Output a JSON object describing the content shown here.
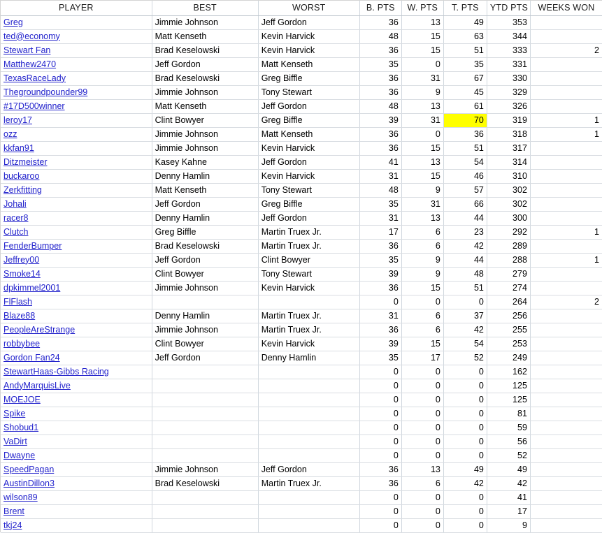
{
  "table": {
    "columns": [
      {
        "key": "player",
        "label": "PLAYER",
        "align": "left"
      },
      {
        "key": "best",
        "label": "BEST",
        "align": "left"
      },
      {
        "key": "worst",
        "label": "WORST",
        "align": "left"
      },
      {
        "key": "bpts",
        "label": "B. PTS",
        "align": "right"
      },
      {
        "key": "wpts",
        "label": "W. PTS",
        "align": "right"
      },
      {
        "key": "tpts",
        "label": "T. PTS",
        "align": "right"
      },
      {
        "key": "ytd",
        "label": "YTD PTS",
        "align": "right"
      },
      {
        "key": "weeks",
        "label": "WEEKS WON",
        "align": "right"
      }
    ],
    "highlight_color": "#ffff00",
    "link_color": "#2222cc",
    "rows": [
      {
        "player": "Greg",
        "best": "Jimmie Johnson",
        "worst": "Jeff Gordon",
        "bpts": "36",
        "wpts": "13",
        "tpts": "49",
        "ytd": "353",
        "weeks": ""
      },
      {
        "player": "ted@economy",
        "best": "Matt Kenseth",
        "worst": "Kevin Harvick",
        "bpts": "48",
        "wpts": "15",
        "tpts": "63",
        "ytd": "344",
        "weeks": ""
      },
      {
        "player": "Stewart Fan",
        "best": "Brad Keselowski",
        "worst": "Kevin Harvick",
        "bpts": "36",
        "wpts": "15",
        "tpts": "51",
        "ytd": "333",
        "weeks": "2"
      },
      {
        "player": "Matthew2470",
        "best": "Jeff Gordon",
        "worst": "Matt Kenseth",
        "bpts": "35",
        "wpts": "0",
        "tpts": "35",
        "ytd": "331",
        "weeks": ""
      },
      {
        "player": "TexasRaceLady",
        "best": "Brad Keselowski",
        "worst": "Greg Biffle",
        "bpts": "36",
        "wpts": "31",
        "tpts": "67",
        "ytd": "330",
        "weeks": ""
      },
      {
        "player": "Thegroundpounder99",
        "best": "Jimmie Johnson",
        "worst": "Tony Stewart",
        "bpts": "36",
        "wpts": "9",
        "tpts": "45",
        "ytd": "329",
        "weeks": ""
      },
      {
        "player": "#17D500winner",
        "best": "Matt Kenseth",
        "worst": "Jeff Gordon",
        "bpts": "48",
        "wpts": "13",
        "tpts": "61",
        "ytd": "326",
        "weeks": ""
      },
      {
        "player": "leroy17",
        "best": "Clint Bowyer",
        "worst": "Greg Biffle",
        "bpts": "39",
        "wpts": "31",
        "tpts": "70",
        "ytd": "319",
        "weeks": "1",
        "highlight": "tpts"
      },
      {
        "player": "ozz",
        "best": "Jimmie Johnson",
        "worst": "Matt Kenseth",
        "bpts": "36",
        "wpts": "0",
        "tpts": "36",
        "ytd": "318",
        "weeks": "1"
      },
      {
        "player": "kkfan91",
        "best": "Jimmie Johnson",
        "worst": "Kevin Harvick",
        "bpts": "36",
        "wpts": "15",
        "tpts": "51",
        "ytd": "317",
        "weeks": ""
      },
      {
        "player": "Ditzmeister",
        "best": "Kasey Kahne",
        "worst": "Jeff Gordon",
        "bpts": "41",
        "wpts": "13",
        "tpts": "54",
        "ytd": "314",
        "weeks": ""
      },
      {
        "player": "buckaroo",
        "best": "Denny Hamlin",
        "worst": "Kevin Harvick",
        "bpts": "31",
        "wpts": "15",
        "tpts": "46",
        "ytd": "310",
        "weeks": ""
      },
      {
        "player": "Zerkfitting",
        "best": "Matt Kenseth",
        "worst": "Tony Stewart",
        "bpts": "48",
        "wpts": "9",
        "tpts": "57",
        "ytd": "302",
        "weeks": ""
      },
      {
        "player": "Johali",
        "best": "Jeff Gordon",
        "worst": "Greg Biffle",
        "bpts": "35",
        "wpts": "31",
        "tpts": "66",
        "ytd": "302",
        "weeks": ""
      },
      {
        "player": "racer8",
        "best": "Denny Hamlin",
        "worst": "Jeff Gordon",
        "bpts": "31",
        "wpts": "13",
        "tpts": "44",
        "ytd": "300",
        "weeks": ""
      },
      {
        "player": "Clutch",
        "best": "Greg Biffle",
        "worst": "Martin Truex Jr.",
        "bpts": "17",
        "wpts": "6",
        "tpts": "23",
        "ytd": "292",
        "weeks": "1"
      },
      {
        "player": "FenderBumper",
        "best": "Brad Keselowski",
        "worst": "Martin Truex Jr.",
        "bpts": "36",
        "wpts": "6",
        "tpts": "42",
        "ytd": "289",
        "weeks": ""
      },
      {
        "player": "Jeffrey00",
        "best": "Jeff Gordon",
        "worst": "Clint Bowyer",
        "bpts": "35",
        "wpts": "9",
        "tpts": "44",
        "ytd": "288",
        "weeks": "1"
      },
      {
        "player": "Smoke14",
        "best": "Clint Bowyer",
        "worst": "Tony Stewart",
        "bpts": "39",
        "wpts": "9",
        "tpts": "48",
        "ytd": "279",
        "weeks": ""
      },
      {
        "player": "dpkimmel2001",
        "best": "Jimmie Johnson",
        "worst": "Kevin Harvick",
        "bpts": "36",
        "wpts": "15",
        "tpts": "51",
        "ytd": "274",
        "weeks": ""
      },
      {
        "player": "FlFlash",
        "best": "",
        "worst": "",
        "bpts": "0",
        "wpts": "0",
        "tpts": "0",
        "ytd": "264",
        "weeks": "2"
      },
      {
        "player": "Blaze88",
        "best": "Denny Hamlin",
        "worst": "Martin Truex Jr.",
        "bpts": "31",
        "wpts": "6",
        "tpts": "37",
        "ytd": "256",
        "weeks": ""
      },
      {
        "player": "PeopleAreStrange",
        "best": "Jimmie Johnson",
        "worst": "Martin Truex Jr.",
        "bpts": "36",
        "wpts": "6",
        "tpts": "42",
        "ytd": "255",
        "weeks": ""
      },
      {
        "player": "robbybee",
        "best": "Clint Bowyer",
        "worst": "Kevin Harvick",
        "bpts": "39",
        "wpts": "15",
        "tpts": "54",
        "ytd": "253",
        "weeks": ""
      },
      {
        "player": "Gordon  Fan24",
        "best": "Jeff Gordon",
        "worst": "Denny Hamlin",
        "bpts": "35",
        "wpts": "17",
        "tpts": "52",
        "ytd": "249",
        "weeks": ""
      },
      {
        "player": "StewartHaas-Gibbs Racing",
        "best": "",
        "worst": "",
        "bpts": "0",
        "wpts": "0",
        "tpts": "0",
        "ytd": "162",
        "weeks": ""
      },
      {
        "player": "AndyMarquisLive",
        "best": "",
        "worst": "",
        "bpts": "0",
        "wpts": "0",
        "tpts": "0",
        "ytd": "125",
        "weeks": ""
      },
      {
        "player": "MOEJOE",
        "best": "",
        "worst": "",
        "bpts": "0",
        "wpts": "0",
        "tpts": "0",
        "ytd": "125",
        "weeks": ""
      },
      {
        "player": "Spike",
        "best": "",
        "worst": "",
        "bpts": "0",
        "wpts": "0",
        "tpts": "0",
        "ytd": "81",
        "weeks": ""
      },
      {
        "player": "Shobud1",
        "best": "",
        "worst": "",
        "bpts": "0",
        "wpts": "0",
        "tpts": "0",
        "ytd": "59",
        "weeks": ""
      },
      {
        "player": "VaDirt",
        "best": "",
        "worst": "",
        "bpts": "0",
        "wpts": "0",
        "tpts": "0",
        "ytd": "56",
        "weeks": ""
      },
      {
        "player": "Dwayne",
        "best": "",
        "worst": "",
        "bpts": "0",
        "wpts": "0",
        "tpts": "0",
        "ytd": "52",
        "weeks": ""
      },
      {
        "player": "SpeedPagan",
        "best": "Jimmie Johnson",
        "worst": "Jeff Gordon",
        "bpts": "36",
        "wpts": "13",
        "tpts": "49",
        "ytd": "49",
        "weeks": ""
      },
      {
        "player": "AustinDillon3",
        "best": "Brad Keselowski",
        "worst": "Martin Truex Jr.",
        "bpts": "36",
        "wpts": "6",
        "tpts": "42",
        "ytd": "42",
        "weeks": ""
      },
      {
        "player": "wilson89",
        "best": "",
        "worst": "",
        "bpts": "0",
        "wpts": "0",
        "tpts": "0",
        "ytd": "41",
        "weeks": ""
      },
      {
        "player": "Brent",
        "best": "",
        "worst": "",
        "bpts": "0",
        "wpts": "0",
        "tpts": "0",
        "ytd": "17",
        "weeks": ""
      },
      {
        "player": "tkj24",
        "best": "",
        "worst": "",
        "bpts": "0",
        "wpts": "0",
        "tpts": "0",
        "ytd": "9",
        "weeks": ""
      }
    ]
  }
}
